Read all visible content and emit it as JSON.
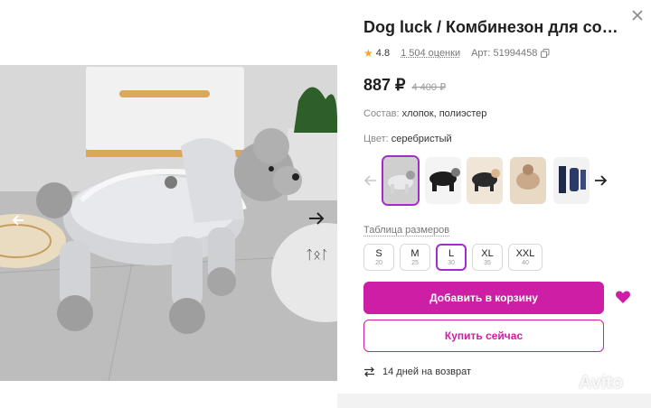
{
  "product": {
    "title": "Dog luck / Комбинезон для собак серебристый",
    "rating": "4.8",
    "reviews": "1 504 оценки",
    "article": "Арт: 51994458",
    "price": "887 ₽",
    "old_price": "4 400 ₽",
    "composition_label": "Состав:",
    "composition_value": "хлопок, полиэстер",
    "color_label": "Цвет:",
    "color_value": "серебристый"
  },
  "swatches": [
    {
      "name": "silver",
      "selected": true
    },
    {
      "name": "black",
      "selected": false
    },
    {
      "name": "black-beige",
      "selected": false
    },
    {
      "name": "beige",
      "selected": false
    },
    {
      "name": "navy",
      "selected": false
    }
  ],
  "size_table_link": "Таблица размеров",
  "sizes": [
    {
      "label": "S",
      "number": "20",
      "selected": false
    },
    {
      "label": "M",
      "number": "25",
      "selected": false
    },
    {
      "label": "L",
      "number": "30",
      "selected": true
    },
    {
      "label": "XL",
      "number": "35",
      "selected": false
    },
    {
      "label": "XXL",
      "number": "40",
      "selected": false
    }
  ],
  "buttons": {
    "add_to_cart": "Добавить в корзину",
    "buy_now": "Купить сейчас"
  },
  "returns": "14 дней на возврат",
  "watermark": "Avito",
  "colors": {
    "accent": "#cc1fa5",
    "selection": "#a52cc8",
    "star": "#f5a623"
  },
  "icons": [
    "close-icon",
    "arrow-left-icon",
    "arrow-right-icon",
    "copy-icon",
    "star-icon",
    "heart-icon",
    "return-arrows-icon"
  ]
}
